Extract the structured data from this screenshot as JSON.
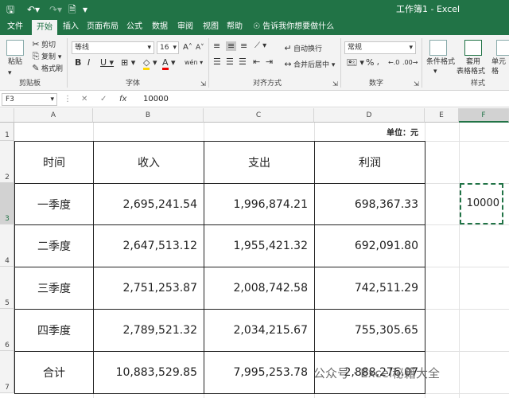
{
  "window": {
    "title": "工作簿1 - Excel"
  },
  "menu": {
    "tabs": [
      "文件",
      "开始",
      "插入",
      "页面布局",
      "公式",
      "数据",
      "审阅",
      "视图",
      "帮助"
    ],
    "active": "开始",
    "tell_me": "告诉我你想要做什么"
  },
  "ribbon": {
    "clipboard": {
      "paste": "粘贴",
      "cut": "剪切",
      "copy": "复制",
      "format_painter": "格式刷",
      "label": "剪贴板"
    },
    "font": {
      "name": "等线",
      "size": "16",
      "label": "字体"
    },
    "alignment": {
      "wrap": "自动换行",
      "merge": "合并后居中",
      "label": "对齐方式"
    },
    "number": {
      "format": "常规",
      "label": "数字"
    },
    "styles": {
      "conditional": "条件格式",
      "table_line1": "套用",
      "table_line2": "表格格式",
      "cell": "单元格",
      "label": "样式"
    }
  },
  "formula_bar": {
    "cell_ref": "F3",
    "value": "10000"
  },
  "sheet": {
    "columns": [
      "A",
      "B",
      "C",
      "D",
      "E",
      "F"
    ],
    "rows": [
      "1",
      "2",
      "3",
      "4",
      "5",
      "6",
      "7"
    ],
    "unit_label": "单位：元",
    "headers": [
      "时间",
      "收入",
      "支出",
      "利润"
    ],
    "data": [
      [
        "一季度",
        "2,695,241.54",
        "1,996,874.21",
        "698,367.33"
      ],
      [
        "二季度",
        "2,647,513.12",
        "1,955,421.32",
        "692,091.80"
      ],
      [
        "三季度",
        "2,751,253.87",
        "2,008,742.58",
        "742,511.29"
      ],
      [
        "四季度",
        "2,789,521.32",
        "2,034,215.67",
        "755,305.65"
      ],
      [
        "合计",
        "10,883,529.85",
        "7,995,253.78",
        "2,888,276.07"
      ]
    ],
    "f3_value": "10000"
  },
  "watermark": "公众号 · Excel秘籍大全"
}
